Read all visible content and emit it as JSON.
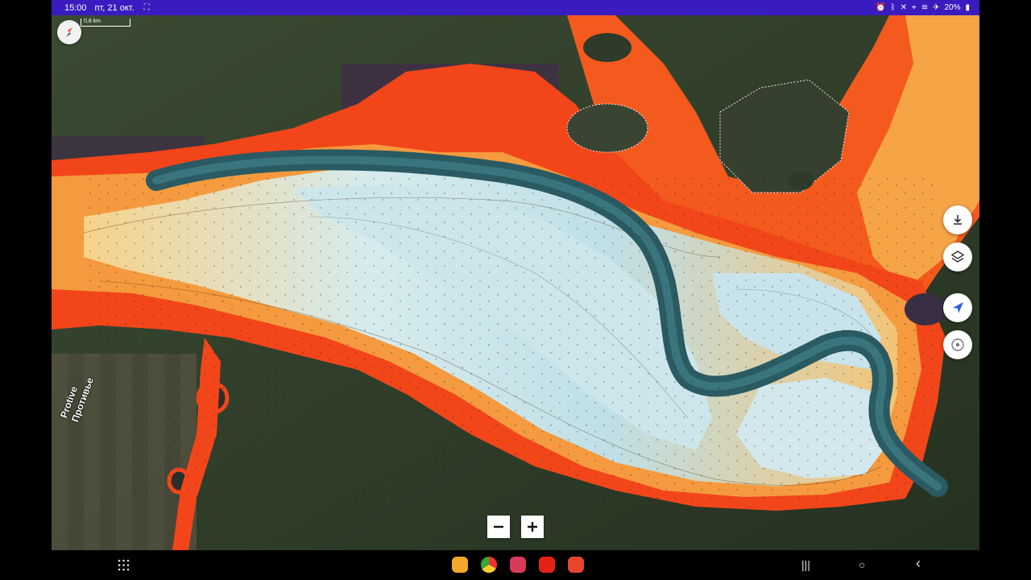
{
  "status_bar": {
    "time": "15:00",
    "date": "пт, 21 окт.",
    "battery": "20%",
    "icons": [
      "alarm-icon",
      "bluetooth-icon",
      "mute-icon",
      "location-icon",
      "wifi-icon",
      "airplane-icon",
      "battery-icon"
    ]
  },
  "map": {
    "scale_label": "0,8 km",
    "place_labels": [
      "Protive",
      "Противье"
    ],
    "depth_colors": {
      "shallow": "#f34719",
      "mid": "#f5a446",
      "sand": "#f6d58c",
      "light": "#cfe6ec",
      "deep": "#2f5f66",
      "land": "#2c3a26"
    }
  },
  "controls": {
    "side_buttons": [
      {
        "name": "download",
        "icon": "download-icon"
      },
      {
        "name": "layers",
        "icon": "layers-icon"
      },
      {
        "name": "my-location",
        "icon": "navigation-arrow-icon"
      },
      {
        "name": "track",
        "icon": "target-icon"
      }
    ],
    "zoom_out": "−",
    "zoom_in": "+"
  },
  "nav_bar": {
    "apps": [
      "notes-app-icon",
      "chrome-icon",
      "camera-app-icon",
      "youtube-icon",
      "app-icon"
    ],
    "recents": "|||",
    "home": "○",
    "back": "‹"
  }
}
